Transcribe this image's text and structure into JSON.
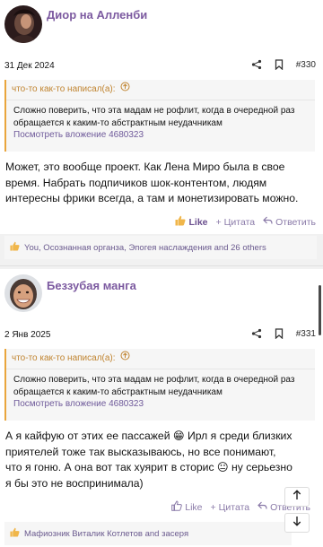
{
  "posts": [
    {
      "author": "Диор на Алленби",
      "date": "31 Дек 2024",
      "number": "#330",
      "quote": {
        "author_line": "что-то как-то написал(а):",
        "text": "Сложно поверить, что эта мадам не рофлит, когда в очередной раз обращается к каким-то абстрактным неудачникам",
        "attachment": "Посмотреть вложение 4680323"
      },
      "message": "Может, это вообще проект. Как Лена Миро была в свое время. Набрать подпичиков шок-контентом, людям интересны фрики всегда, а там и монетизировать можно.",
      "actions": {
        "like": "Like",
        "quote": "Цитата",
        "reply": "Ответить"
      },
      "reactions": "You, Осознанная органза, Эпогея наслаждения and 26 others"
    },
    {
      "author": "Беззубая манга",
      "date": "2 Янв 2025",
      "number": "#331",
      "quote": {
        "author_line": "что-то как-то написал(а):",
        "text": "Сложно поверить, что эта мадам не рофлит, когда в очередной раз обращается к каким-то абстрактным неудачникам",
        "attachment": "Посмотреть вложение 4680323"
      },
      "message": "А я кайфую от этих ее пассажей 😁 Ирл я среди близких приятелей тоже так высказываюсь, но все понимают, что я гоню. А она вот так хуярит в сторис 😐 ну серьезно я бы это не воспринимала)",
      "actions": {
        "like": "Like",
        "quote": "Цитата",
        "reply": "Ответить"
      },
      "reactions": "Мафиозник Виталик Котлетов and засеря"
    }
  ],
  "colors": {
    "accent": "#7c5aa0",
    "quote_border": "#e9a53c",
    "link": "#6f5a9a",
    "like_icon": "#f0b64a"
  }
}
